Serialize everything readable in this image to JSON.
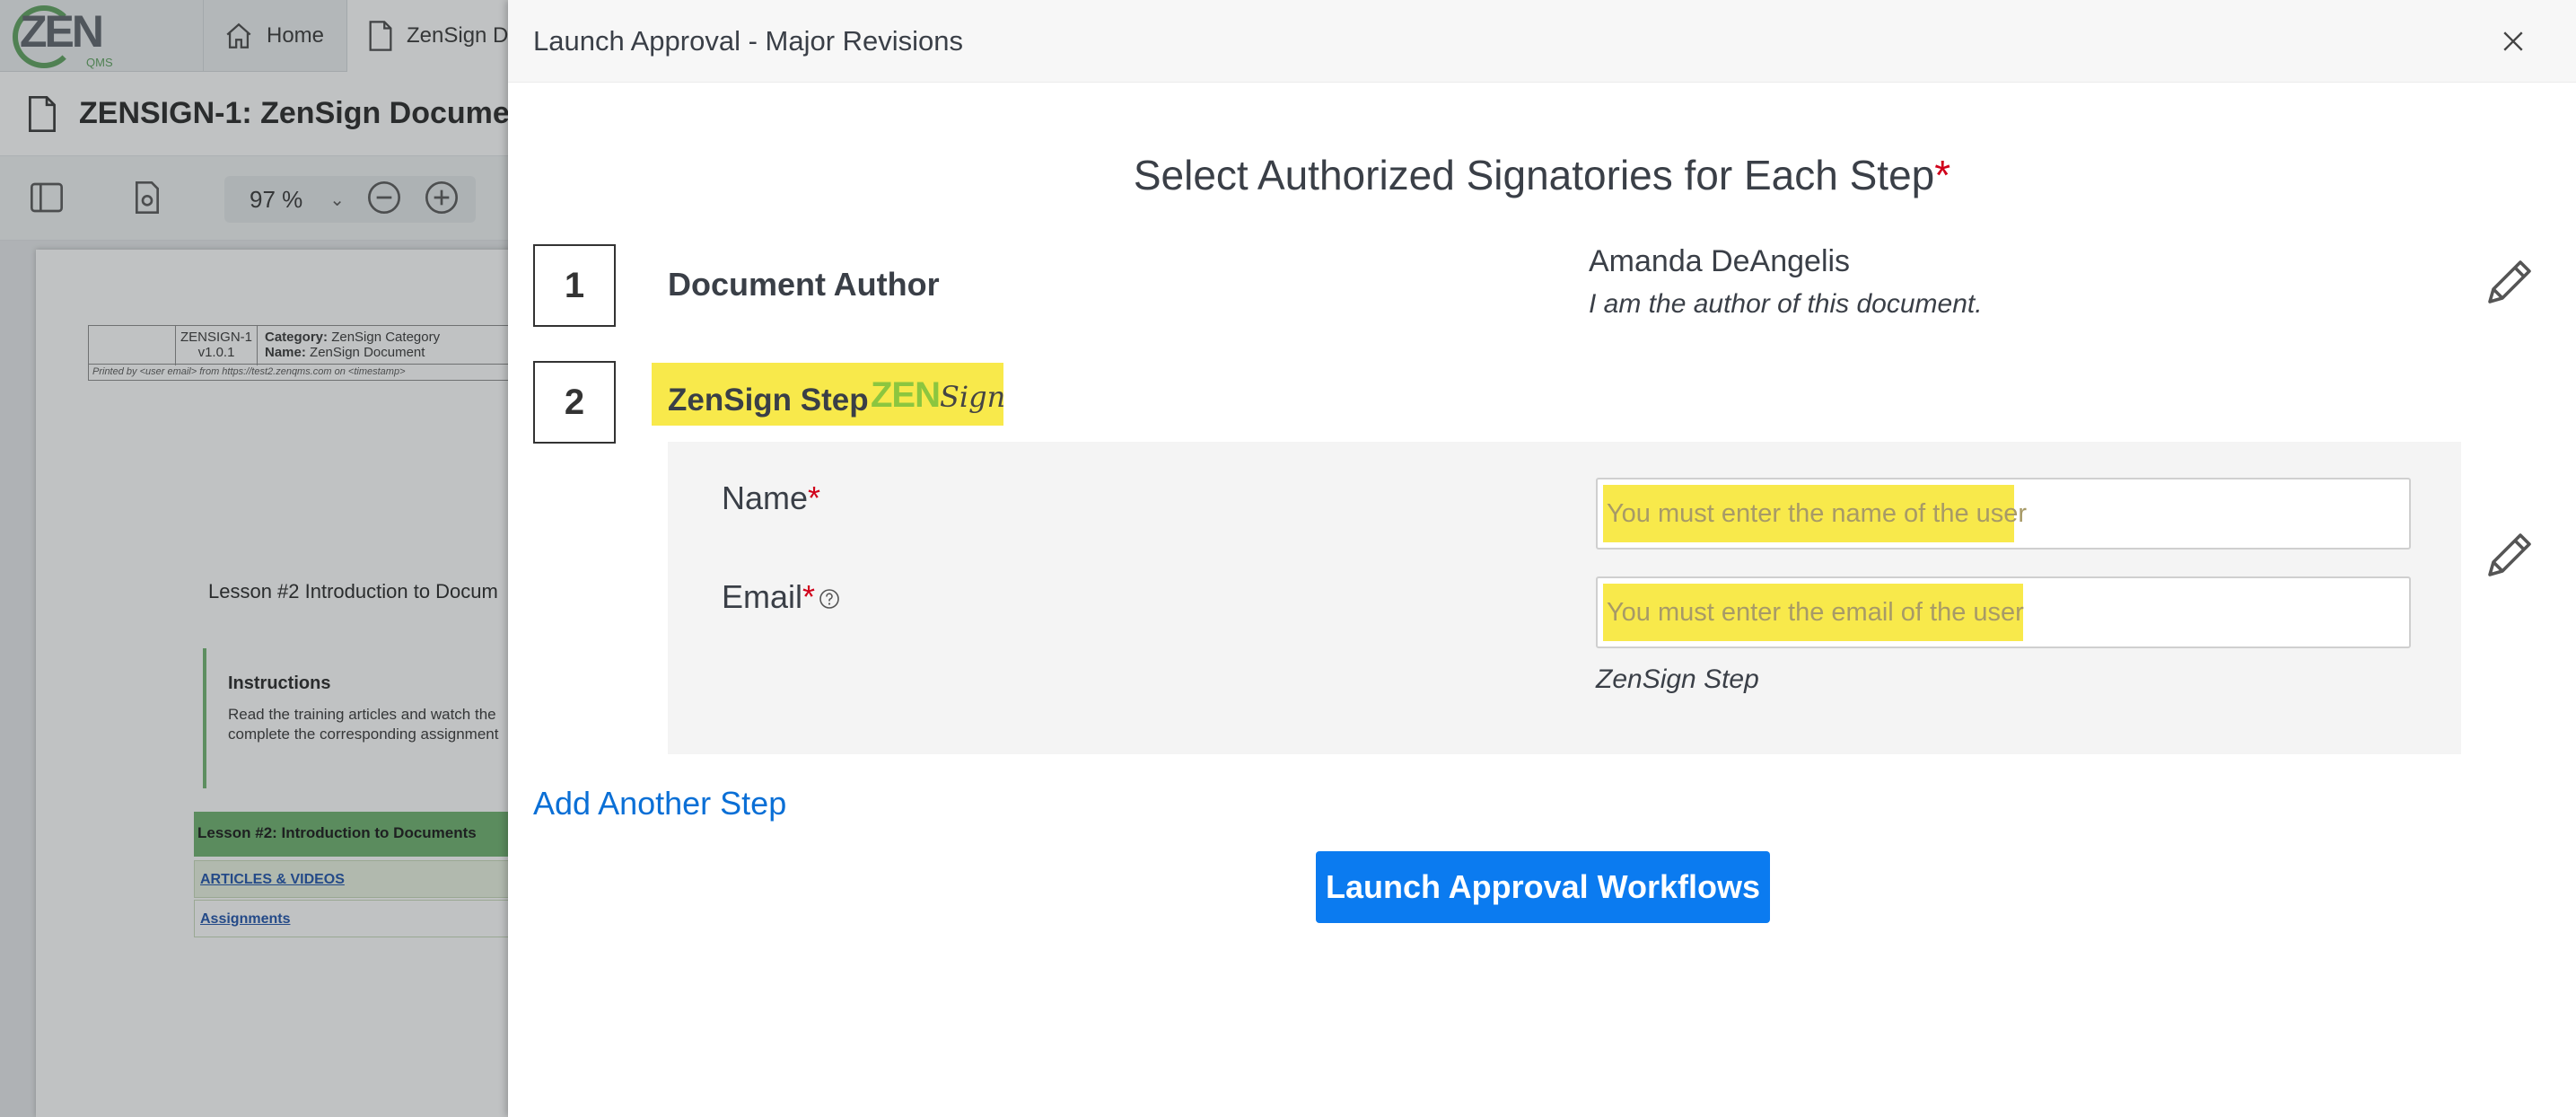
{
  "app": {
    "logo_text": "ZEN",
    "logo_sub": "QMS",
    "tabs": [
      {
        "label": "Home",
        "icon": "home-icon"
      },
      {
        "label": "ZenSign Do",
        "icon": "document-icon"
      }
    ],
    "document_title": "ZENSIGN-1: ZenSign Docume",
    "zoom_value": "97",
    "zoom_unit": "%"
  },
  "document_preview": {
    "header_id": "ZENSIGN-1",
    "header_version": "v1.0.1",
    "header_category_label": "Category:",
    "header_category_value": "ZenSign Category",
    "header_name_label": "Name:",
    "header_name_value": "ZenSign Document",
    "printed_line": "Printed by <user email> from https://test2.zenqms.com on <timestamp>",
    "lesson_heading": "Lesson #2 Introduction to Docum",
    "instructions_title": "Instructions",
    "instructions_body_1": "Read the training articles and watch the",
    "instructions_body_2": "complete the corresponding assignment",
    "green_bar_text": "Lesson #2: Introduction to Documents",
    "link_1": "ARTICLES & VIDEOS",
    "link_2": "Assignments"
  },
  "modal": {
    "title": "Launch Approval - Major Revisions",
    "section_title": "Select Authorized Signatories for Each Step",
    "required_mark": "*",
    "steps": [
      {
        "number": "1",
        "title": "Document Author",
        "person": "Amanda DeAngelis",
        "note": "I am the author of this document."
      },
      {
        "number": "2",
        "title": "ZenSign Step",
        "logo_zen": "ZEN",
        "logo_sign": "Sign",
        "name_label": "Name",
        "email_label": "Email",
        "name_placeholder": "You must enter the name of the user",
        "email_placeholder": "You must enter the email of the user",
        "caption": "ZenSign Step"
      }
    ],
    "add_step_label": "Add Another Step",
    "launch_label": "Launch Approval Workflows"
  },
  "colors": {
    "highlight": "#f8e94b",
    "primary_button": "#0b7bf0",
    "link": "#0a6fd6",
    "required": "#d0021b",
    "zensign_green": "#8cc63f"
  }
}
